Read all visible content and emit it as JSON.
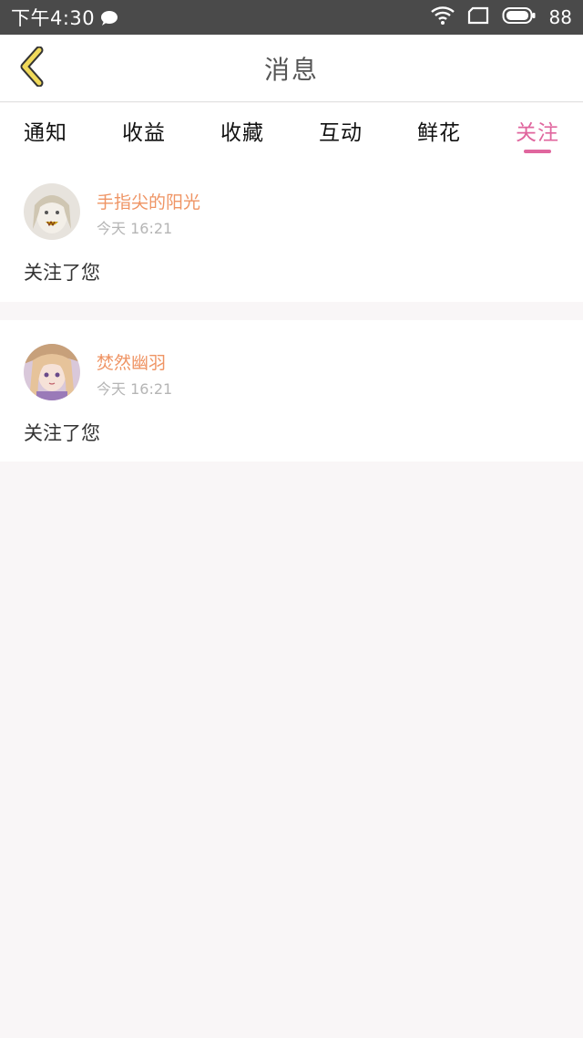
{
  "status_bar": {
    "time": "下午4:30",
    "battery": "88",
    "icons": [
      "chat-bubble-icon",
      "wifi-icon",
      "screen-icon",
      "battery-icon"
    ]
  },
  "header": {
    "title": "消息",
    "back_icon": "chevron-left-icon"
  },
  "tabs": [
    {
      "label": "通知",
      "active": false
    },
    {
      "label": "收益",
      "active": false
    },
    {
      "label": "收藏",
      "active": false
    },
    {
      "label": "互动",
      "active": false
    },
    {
      "label": "鲜花",
      "active": false
    },
    {
      "label": "关注",
      "active": true
    }
  ],
  "messages": [
    {
      "user": "手指尖的阳光",
      "time": "今天  16:21",
      "text": "关注了您"
    },
    {
      "user": "焚然幽羽",
      "time": "今天  16:21",
      "text": "关注了您"
    }
  ],
  "colors": {
    "accent": "#e0669e",
    "username": "#ef9464",
    "back_icon": "#f0d95a",
    "status_bar": "#4a4a4a"
  }
}
